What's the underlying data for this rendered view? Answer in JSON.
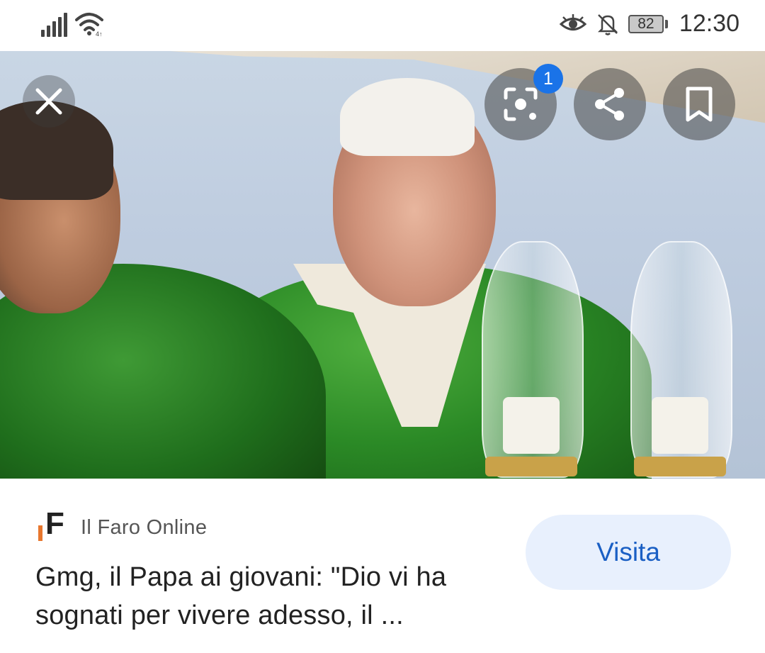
{
  "status_bar": {
    "battery": "82",
    "time": "12:30",
    "icons": [
      "signal-icon",
      "wifi-icon",
      "eye-icon",
      "bell-off-icon",
      "battery-icon"
    ]
  },
  "viewer": {
    "close_icon": "close-icon",
    "lens_icon": "lens-icon",
    "lens_badge": "1",
    "share_icon": "share-icon",
    "bookmark_icon": "bookmark-icon"
  },
  "card": {
    "source_logo_letter": "F",
    "source_name": "Il Faro Online",
    "headline": "Gmg, il Papa ai giovani: \"Dio vi ha sognati per vivere adesso, il ...",
    "visit_label": "Visita"
  },
  "colors": {
    "accent": "#1a73e8",
    "visit_bg": "#e8f0fd",
    "visit_text": "#1a5fc4",
    "logo_accent": "#e8772e"
  }
}
